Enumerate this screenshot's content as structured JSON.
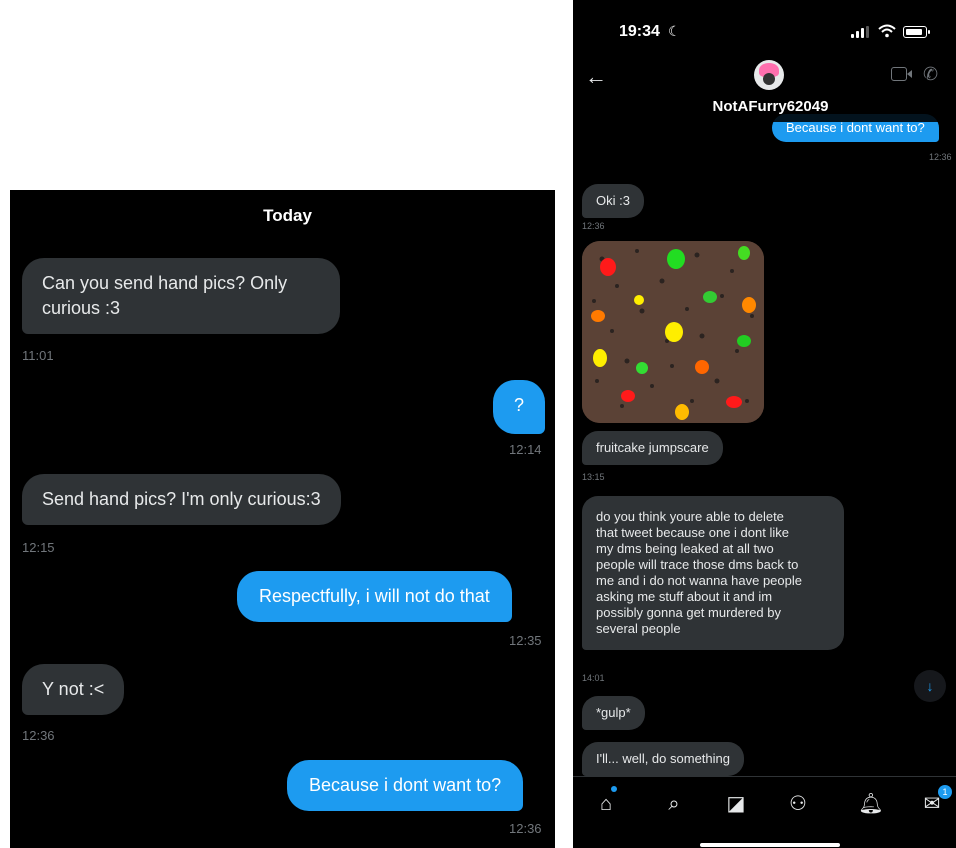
{
  "left": {
    "day_label": "Today",
    "messages": [
      {
        "side": "in",
        "lines": [
          "Can you send hand pics? Only",
          "curious :3"
        ],
        "time": "11:01"
      },
      {
        "side": "out",
        "lines": [
          "?"
        ],
        "time": "12:14"
      },
      {
        "side": "in",
        "lines": [
          "Send hand pics? I'm only curious:3"
        ],
        "time": "12:15"
      },
      {
        "side": "out",
        "lines": [
          "Respectfully, i will not do that"
        ],
        "time": "12:35"
      },
      {
        "side": "in",
        "lines": [
          "Y not :<"
        ],
        "time": "12:36"
      },
      {
        "side": "out",
        "lines": [
          "Because i dont want to?"
        ],
        "time": "12:36"
      }
    ]
  },
  "right": {
    "status": {
      "time": "19:34",
      "moon": "☾"
    },
    "header": {
      "back": "←",
      "name": "NotAFurry62049",
      "phone": "✆"
    },
    "messages": [
      {
        "side": "out",
        "lines": [
          "Because i dont want to?"
        ],
        "time": "12:36"
      },
      {
        "side": "in",
        "lines": [
          "Oki :3"
        ],
        "time": "12:36"
      },
      {
        "side": "in",
        "lines": [
          "fruitcake jumpscare"
        ],
        "time": "13:15"
      },
      {
        "side": "in",
        "lines": [
          "do you think youre able to delete",
          "that tweet because one i dont like",
          "my dms being leaked at all two",
          "people will trace those dms back to",
          "me and i do not wanna have people",
          "asking me stuff about it and im",
          "possibly gonna get murdered by",
          "several people"
        ],
        "time": "14:01"
      },
      {
        "side": "in",
        "lines": [
          "*gulp*"
        ],
        "time": ""
      },
      {
        "side": "in",
        "lines": [
          "I'll... well, do something"
        ],
        "time": ""
      }
    ],
    "scroll_down": "↓",
    "tabs": {
      "home": "⌂",
      "search": "⌕",
      "grok": "◪",
      "communities": "⚇",
      "notifications": "🔔︎",
      "messages": "✉︎",
      "messages_badge": "1"
    }
  },
  "colors": {
    "background": "#000000",
    "incoming_bubble": "#2f3336",
    "outgoing_bubble": "#1d9bf0",
    "timestamp": "#71767b"
  }
}
